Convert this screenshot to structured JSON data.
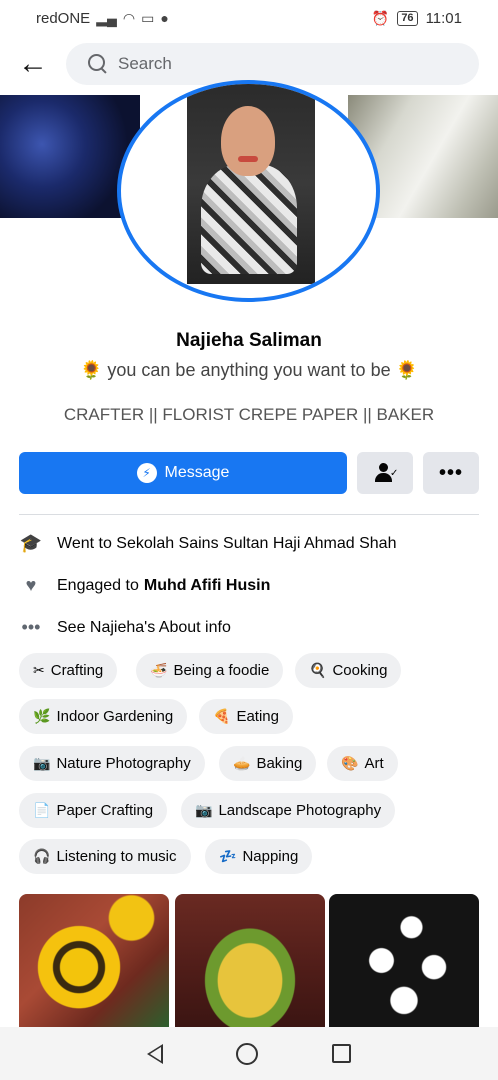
{
  "status_bar": {
    "carrier": "redONE",
    "battery": "76",
    "time": "11:01"
  },
  "search": {
    "placeholder": "Search"
  },
  "profile": {
    "name": "Najieha Saliman",
    "bio": "you can be anything you want to be",
    "tagline": "CRAFTER || FLORIST CREPE PAPER || BAKER"
  },
  "actions": {
    "message_label": "Message"
  },
  "intro": {
    "education": "Went to Sekolah Sains Sultan Haji Ahmad Shah",
    "relationship_prefix": "Engaged to",
    "relationship_partner": "Muhd Afifi Husin",
    "about_link": "See Najieha's About info"
  },
  "hobbies": [
    {
      "icon": "scissors-icon",
      "label": "Crafting"
    },
    {
      "icon": "noodles-icon",
      "label": "Being a foodie"
    },
    {
      "icon": "cooking-icon",
      "label": "Cooking"
    },
    {
      "icon": "plant-icon",
      "label": "Indoor Gardening"
    },
    {
      "icon": "pizza-icon",
      "label": "Eating"
    },
    {
      "icon": "camera-icon",
      "label": "Nature Photography"
    },
    {
      "icon": "pie-icon",
      "label": "Baking"
    },
    {
      "icon": "palette-icon",
      "label": "Art"
    },
    {
      "icon": "paper-icon",
      "label": "Paper Crafting"
    },
    {
      "icon": "camera-icon",
      "label": "Landscape Photography"
    },
    {
      "icon": "headphones-icon",
      "label": "Listening to music"
    },
    {
      "icon": "zzz-icon",
      "label": "Napping"
    }
  ],
  "colors": {
    "accent": "#1877f2",
    "chip_bg": "#eff0f2"
  }
}
